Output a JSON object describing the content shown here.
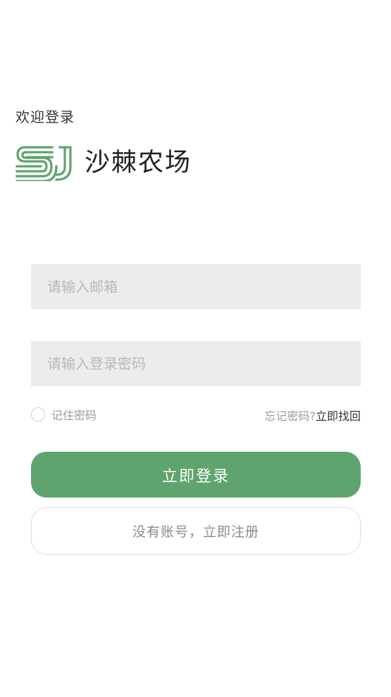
{
  "header": {
    "welcome": "欢迎登录",
    "brand_name": "沙棘农场",
    "logo_text": "SJ",
    "logo_color": "#5fa46e"
  },
  "form": {
    "email_placeholder": "请输入邮箱",
    "email_value": "",
    "password_placeholder": "请输入登录密码",
    "password_value": "",
    "remember_label": "记住密码",
    "remember_checked": false,
    "forgot_question": "忘记密码?",
    "forgot_link": "立即找回"
  },
  "actions": {
    "login_label": "立即登录",
    "register_label": "没有账号，立即注册"
  },
  "colors": {
    "accent": "#5fa46e",
    "input_bg": "#ececec",
    "text_muted": "#9a9a9a"
  }
}
